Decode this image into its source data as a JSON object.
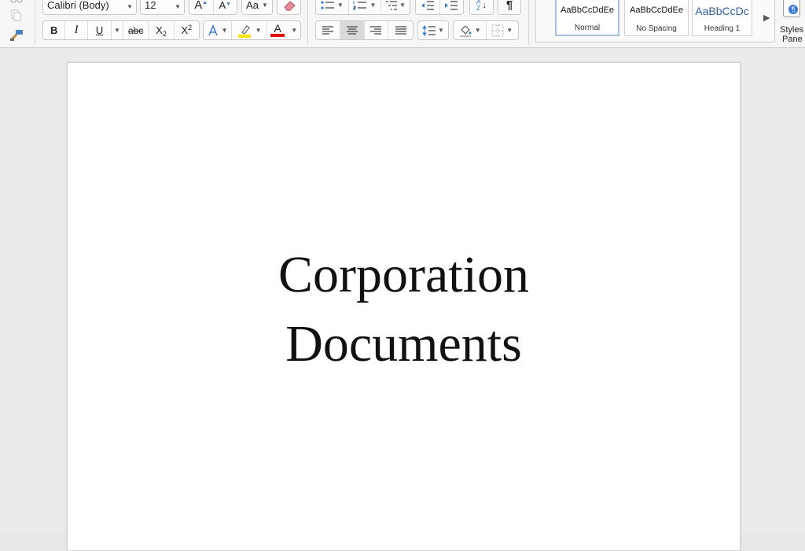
{
  "toolbar": {
    "font": {
      "family": "Calibri (Body)",
      "size": "12"
    },
    "format": {
      "bold": "B",
      "italic": "I",
      "underline": "U",
      "strikethrough": "abc",
      "subscript": "X",
      "subscript_mark": "2",
      "superscript": "X",
      "superscript_mark": "2",
      "font_color_letter": "A"
    },
    "grow_font": "A",
    "shrink_font": "A",
    "change_case": "Aa",
    "sort": {
      "top": "A",
      "bottom": "Z"
    },
    "pilcrow": "¶",
    "colors": {
      "highlight": "#f7e400",
      "font_color": "#e01010",
      "accent_blue": "#3b7bd4"
    }
  },
  "styles": {
    "items": [
      {
        "preview": "AaBbCcDdEe",
        "name": "Normal",
        "active": true
      },
      {
        "preview": "AaBbCcDdEe",
        "name": "No Spacing",
        "active": false
      },
      {
        "preview": "AaBbCcDc",
        "name": "Heading 1",
        "active": false,
        "color": "#2f5d9e"
      }
    ],
    "pane_label_line1": "Styles",
    "pane_label_line2": "Pane"
  },
  "document": {
    "lines": [
      "Corporation",
      "Documents"
    ]
  }
}
